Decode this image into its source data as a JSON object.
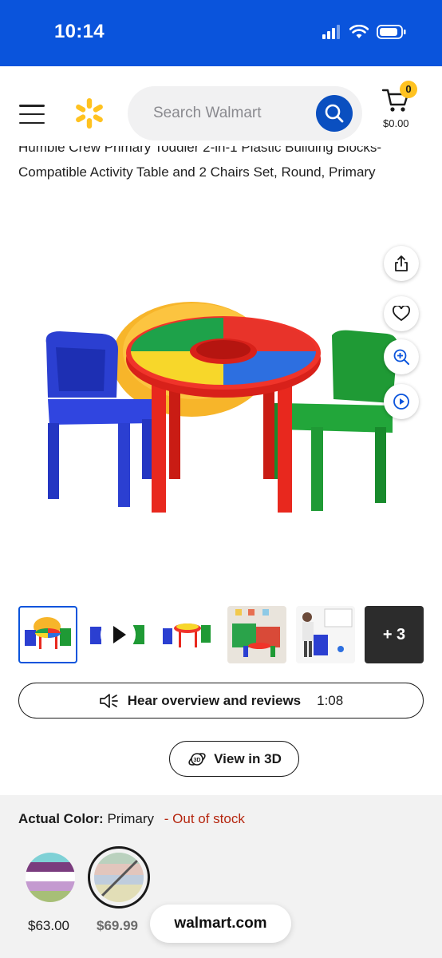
{
  "status_bar": {
    "time": "10:14"
  },
  "header": {
    "search_placeholder": "Search Walmart",
    "cart": {
      "count": "0",
      "total": "$0.00"
    }
  },
  "product": {
    "title_partial": "Humble Crew Primary Toddler 2-in-1 Plastic Building Blocks-",
    "title": "Compatible Activity Table and 2 Chairs Set, Round, Primary"
  },
  "gallery": {
    "more_count": "+ 3"
  },
  "actions": {
    "hear_label": "Hear overview and reviews",
    "hear_duration": "1:08",
    "view3d_label": "View in 3D"
  },
  "variants": {
    "color_label": "Actual Color:",
    "color_value": "Primary",
    "stock_status": "- Out of stock",
    "options": [
      {
        "price": "$63.00"
      },
      {
        "price": "$69.99"
      }
    ]
  },
  "bottom_bar": {
    "domain": "walmart.com"
  },
  "colors": {
    "brand_blue": "#0a54dc",
    "spark_yellow": "#ffc220",
    "out_of_stock_red": "#b5260f"
  }
}
